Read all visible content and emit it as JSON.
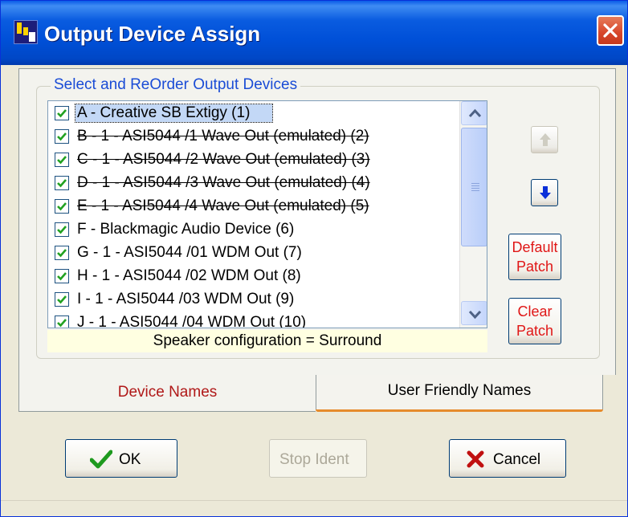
{
  "window": {
    "title": "Output Device Assign"
  },
  "group": {
    "label": "Select and ReOrder Output Devices"
  },
  "devices": [
    {
      "label": "A  - Creative SB Extigy (1)",
      "checked": true,
      "struck": false,
      "selected": true
    },
    {
      "label": "B - 1 - ASI5044 /1 Wave Out (emulated) (2)",
      "checked": true,
      "struck": true,
      "selected": false
    },
    {
      "label": "C - 1 - ASI5044 /2 Wave Out (emulated) (3)",
      "checked": true,
      "struck": true,
      "selected": false
    },
    {
      "label": "D - 1 - ASI5044 /3 Wave Out (emulated) (4)",
      "checked": true,
      "struck": true,
      "selected": false
    },
    {
      "label": "E - 1 - ASI5044 /4 Wave Out (emulated) (5)",
      "checked": true,
      "struck": true,
      "selected": false
    },
    {
      "label": "F  - Blackmagic Audio Device (6)",
      "checked": true,
      "struck": false,
      "selected": false
    },
    {
      "label": "G - 1 - ASI5044 /01 WDM Out (7)",
      "checked": true,
      "struck": false,
      "selected": false
    },
    {
      "label": "H - 1 - ASI5044 /02 WDM Out (8)",
      "checked": true,
      "struck": false,
      "selected": false
    },
    {
      "label": "I   - 1 - ASI5044 /03 WDM Out (9)",
      "checked": true,
      "struck": false,
      "selected": false
    },
    {
      "label": "J  - 1 - ASI5044 /04 WDM Out (10)",
      "checked": true,
      "struck": false,
      "selected": false
    }
  ],
  "speaker_config": "Speaker configuration = Surround",
  "buttons": {
    "move_up": {
      "icon": "arrow-up-icon",
      "enabled": false
    },
    "move_down": {
      "icon": "arrow-down-icon",
      "enabled": true
    },
    "default_patch": {
      "line1": "Default",
      "line2": "Patch"
    },
    "clear_patch": {
      "line1": "Clear",
      "line2": "Patch"
    },
    "ok": "OK",
    "stop_ident": "Stop Ident",
    "cancel": "Cancel"
  },
  "tabs": [
    {
      "label": "Device Names",
      "active": true
    },
    {
      "label": "User Friendly Names",
      "active": false
    }
  ],
  "colors": {
    "titlebar": "#0050d8",
    "accent_red": "#e01616",
    "selection": "#c3d8f6",
    "tab_highlight": "#e68b2c"
  }
}
